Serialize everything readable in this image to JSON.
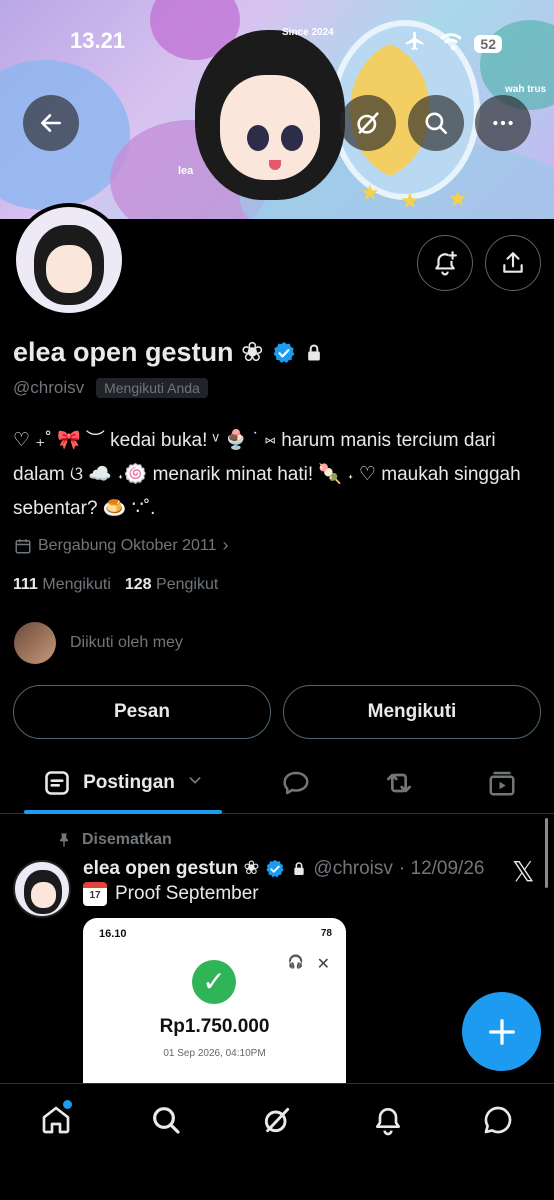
{
  "status_bar": {
    "time": "13.21",
    "battery": "52"
  },
  "banner": {
    "since": "Since 2024",
    "wah": "wah trus",
    "lea": "lea"
  },
  "profile": {
    "name": "elea open gestun ❀",
    "handle": "@chroisv",
    "follows_you": "Mengikuti Anda",
    "bio": "♡ ₊˚ 🎀 ︶ kedai buka! ᵛ 🍨 ˙ ⑅ harum manis tercium dari dalam ଓ ☁️ ˖🍥 menarik minat hati! 🍡 ˖ ♡ maukah singgah sebentar? 🍮 ∵˚.",
    "joined": "Bergabung Oktober 2011",
    "following_count": "111",
    "following_label": "Mengikuti",
    "followers_count": "128",
    "followers_label": "Pengikut",
    "followed_by": "Diikuti oleh mey"
  },
  "actions": {
    "message": "Pesan",
    "following": "Mengikuti"
  },
  "tabs": {
    "active_label": "Postingan"
  },
  "post": {
    "pinned_label": "Disematkan",
    "name": "elea open gestun ❀",
    "handle": "@chroisv",
    "date": "· 12/09/26",
    "text": "Proof September",
    "calendar_day": "17",
    "screenshot": {
      "time": "16.10",
      "battery": "78",
      "amount": "Rp1.750.000",
      "date": "01 Sep 2026, 04:10PM"
    }
  },
  "colors": {
    "accent": "#1d9bf0",
    "muted": "#71767b",
    "text": "#e7e9ea",
    "border": "#536471"
  }
}
